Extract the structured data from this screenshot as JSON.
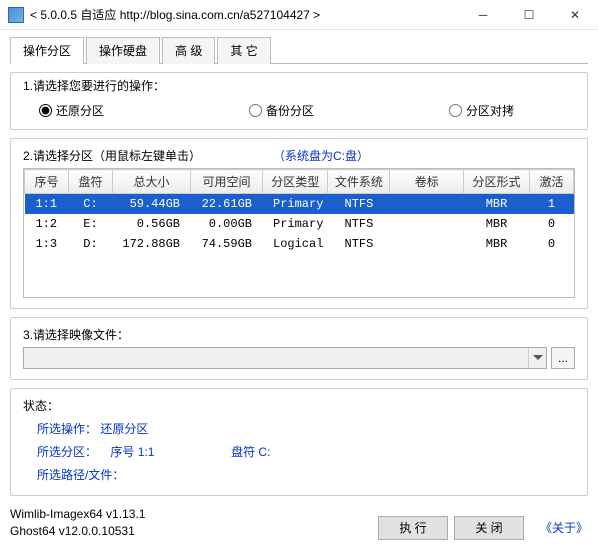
{
  "window": {
    "title": "< 5.0.0.5 自适应 http://blog.sina.com.cn/a527104427 >"
  },
  "tabs": {
    "t0": "操作分区",
    "t1": "操作硬盘",
    "t2": "高 级",
    "t3": "其 它"
  },
  "section1": {
    "title": "1.请选择您要进行的操作：",
    "opt_restore": "还原分区",
    "opt_backup": "备份分区",
    "opt_clone": "分区对拷"
  },
  "section2": {
    "title": "2.请选择分区（用鼠标左键单击）",
    "sys_hint": "（系统盘为C:盘）",
    "headers": {
      "seq": "序号",
      "drive": "盘符",
      "total": "总大小",
      "free": "可用空间",
      "ptype": "分区类型",
      "fs": "文件系统",
      "vol": "卷标",
      "form": "分区形式",
      "act": "激活"
    },
    "rows": [
      {
        "seq": "1:1",
        "drive": "C:",
        "total": "59.44GB",
        "free": "22.61GB",
        "ptype": "Primary",
        "fs": "NTFS",
        "vol": "",
        "form": "MBR",
        "act": "1"
      },
      {
        "seq": "1:2",
        "drive": "E:",
        "total": "0.56GB",
        "free": "0.00GB",
        "ptype": "Primary",
        "fs": "NTFS",
        "vol": "",
        "form": "MBR",
        "act": "0"
      },
      {
        "seq": "1:3",
        "drive": "D:",
        "total": "172.88GB",
        "free": "74.59GB",
        "ptype": "Logical",
        "fs": "NTFS",
        "vol": "",
        "form": "MBR",
        "act": "0"
      }
    ]
  },
  "section3": {
    "title": "3.请选择映像文件：",
    "browse": "..."
  },
  "status": {
    "title": "状态：",
    "op_label": "所选操作：",
    "op_value": "还原分区",
    "part_label": "所选分区：",
    "part_seq_label": "序号 ",
    "part_seq": "1:1",
    "drive_label": "盘符 ",
    "drive_value": "C:",
    "path_label": "所选路径/文件："
  },
  "versions": {
    "v1": "Wimlib-Imagex64 v1.13.1",
    "v2": "Ghost64 v12.0.0.10531"
  },
  "buttons": {
    "execute": "执 行",
    "close": "关 闭",
    "about": "《关于》"
  }
}
